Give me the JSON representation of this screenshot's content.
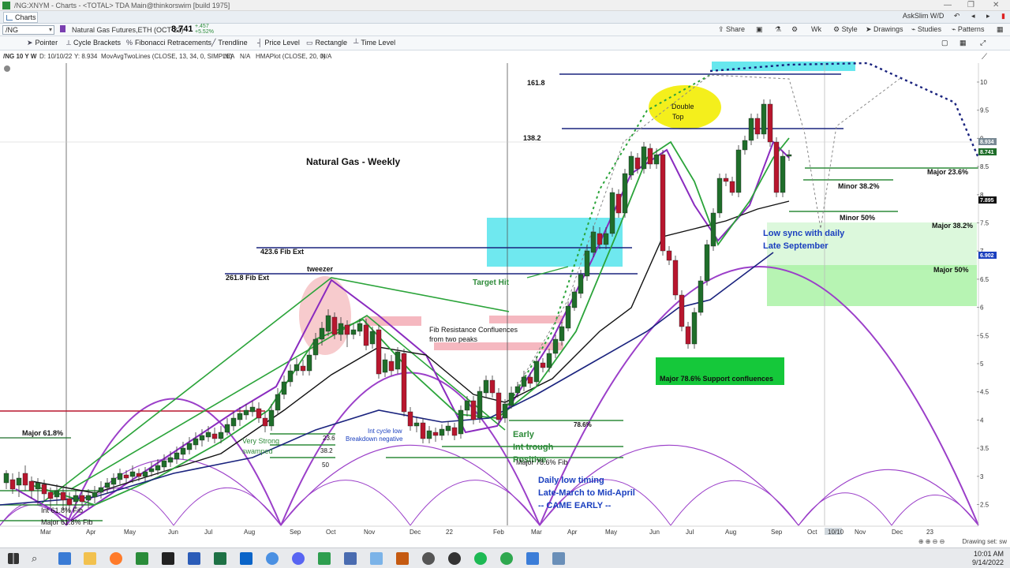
{
  "window": {
    "title": "/NG:XNYM - Charts - <TOTAL> TDA Main@thinkorswim [build 1975]",
    "tab_label": "Charts",
    "right_info": "AskSlim W/D"
  },
  "symbol_row": {
    "symbol": "/NG",
    "instrument": "Natural Gas Futures,ETH (OCT 22)",
    "price": "8.741",
    "change_top": "+.457",
    "change_bottom": "+5.52%",
    "share": "Share",
    "wk": "Wk",
    "style": "Style",
    "drawings": "Drawings",
    "studies": "Studies",
    "patterns": "Patterns"
  },
  "toolbar": {
    "pointer": "Pointer",
    "cycle": "Cycle Brackets",
    "fib": "Fibonacci Retracements",
    "trendline": "Trendline",
    "price_level": "Price Level",
    "rectangle": "Rectangle",
    "time_level": "Time Level"
  },
  "study_row": {
    "s1": "/NG 10 Y W",
    "s2": "D: 10/10/22",
    "s3": "Y: 8.934",
    "s4": "MovAvgTwoLines (CLOSE, 13, 34, 0, SIMPLE)",
    "s5": "N/A",
    "s6": "N/A",
    "s7": "HMAPlot (CLOSE, 20, 0)",
    "s8": "N/A"
  },
  "colors": {
    "up_candle": "#1f6e2a",
    "down_candle": "#b8162e",
    "cycle": "#9b3fc9",
    "fib_line": "#1a237e",
    "support_box": "#15c83a",
    "cyan_box": "#56e4ec",
    "pink_box": "#f2a0ab"
  },
  "annotations": {
    "chart_title": "Natural Gas - Weekly",
    "double_top_1": "Double",
    "double_top_2": "Top",
    "fib_161": "161.8",
    "fib_138": "138.2",
    "fib_423": "423.6 Fib Ext",
    "fib_261": "261.8 Fib Ext",
    "tweezer": "tweezer",
    "target_hit": "Target Hit",
    "fib_res_1": "Fib Resistance Confluences",
    "fib_res_2": "from two peaks",
    "major_786": "Major 78.6% Support confluences",
    "major_236": "Major 23.6%",
    "minor_382": "Minor 38.2%",
    "minor_50": "Minor 50%",
    "major_382": "Major 38.2%",
    "major_50": "Major 50%",
    "low_sync_1": "Low sync with daily",
    "low_sync_2": "Late September",
    "daily_low_1": "Daily low timing",
    "daily_low_2": "Late-March to Mid-April",
    "daily_low_3": "-- CAME EARLY --",
    "early_1": "Early",
    "early_2": "Int trough",
    "early_3": "Positive",
    "fib_786_pct": "78.6%",
    "major_786_fib": "Major 78.6% Fib",
    "major_618": "Major 61.8%",
    "int_618_fib": "Int 61.8% Fib",
    "major_618_fib": "Major 61.8% Fib",
    "very_strong": "Very Strong",
    "swamped": "swamped",
    "int_cycle_1": "Int cycle low",
    "int_cycle_2": "Breakdown negative",
    "val_236": "23.6",
    "val_382": "38.2",
    "val_50": "50"
  },
  "y_axis": [
    "10",
    "9.5",
    "9",
    "8.5",
    "8",
    "7.5",
    "7",
    "6.5",
    "6",
    "5.5",
    "5",
    "4.5",
    "4",
    "3.5",
    "3",
    "2.5"
  ],
  "price_tags": {
    "tag1": "8.934",
    "tag2": "8.741",
    "tag3": "7.895",
    "tag4": "6.902"
  },
  "x_axis": [
    "Mar",
    "Apr",
    "May",
    "Jun",
    "Jul",
    "Aug",
    "Sep",
    "Oct",
    "Nov",
    "Dec",
    "22",
    "Feb",
    "Mar",
    "Apr",
    "May",
    "Jun",
    "Jul",
    "Aug",
    "Sep",
    "Oct",
    "10/10",
    "Nov",
    "Dec",
    "23"
  ],
  "status": {
    "drawing_settings": "Drawing set: sw"
  },
  "taskbar": {
    "time": "10:01 AM",
    "date": "9/14/2022"
  }
}
